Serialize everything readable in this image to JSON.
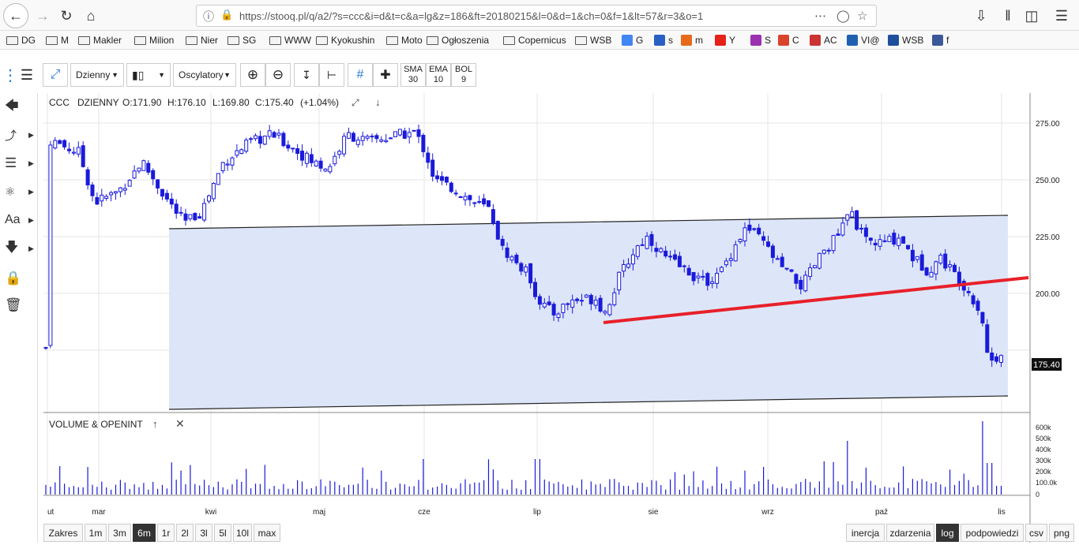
{
  "browser": {
    "url": "https://stooq.pl/q/a2/?s=ccc&i=d&t=c&a=lg&z=186&ft=20180215&l=0&d=1&ch=0&f=1&lt=57&r=3&o=1"
  },
  "bookmarks": [
    {
      "label": "DG",
      "icon": "folder-icon"
    },
    {
      "label": "M",
      "icon": "folder-icon"
    },
    {
      "label": "Makler",
      "icon": "folder-icon"
    },
    {
      "label": "Milion",
      "icon": "folder-icon"
    },
    {
      "label": "Nier",
      "icon": "folder-icon"
    },
    {
      "label": "SG",
      "icon": "folder-icon"
    },
    {
      "label": "WWW",
      "icon": "folder-icon"
    },
    {
      "label": "Kyokushin",
      "icon": "folder-icon"
    },
    {
      "label": "Moto",
      "icon": "folder-icon"
    },
    {
      "label": "Ogłoszenia",
      "icon": "folder-icon"
    },
    {
      "label": "Copernicus",
      "icon": "folder-icon"
    },
    {
      "label": "WSB",
      "icon": "folder-icon"
    },
    {
      "label": "G",
      "icon": "google-icon"
    },
    {
      "label": "s",
      "icon": "oq-icon"
    },
    {
      "label": "m",
      "icon": "m-site-icon"
    },
    {
      "label": "Y",
      "icon": "youtube-icon"
    },
    {
      "label": "S",
      "icon": "s-site-icon"
    },
    {
      "label": "C",
      "icon": "c-site-icon"
    },
    {
      "label": "AC",
      "icon": "ac-site-icon"
    },
    {
      "label": "VI@",
      "icon": "vi-site-icon"
    },
    {
      "label": "WSB",
      "icon": "wsb-site-icon"
    },
    {
      "label": "f",
      "icon": "facebook-icon"
    }
  ],
  "toolbar": {
    "interval": "Dzienny",
    "oscillators": "Oscylatory",
    "indicators": [
      {
        "name": "SMA",
        "value": "30"
      },
      {
        "name": "EMA",
        "value": "10"
      },
      {
        "name": "BOL",
        "value": "9"
      }
    ]
  },
  "chart": {
    "header": {
      "ticker": "CCC",
      "interval": "DZIENNY",
      "open": "O:171.90",
      "high": "H:176.10",
      "low": "L:169.80",
      "close": "C:175.40",
      "change": "(+1.04%)"
    },
    "price_label": "175.40",
    "volume_title": "VOLUME & OPENINT"
  },
  "chart_data": {
    "type": "candlestick",
    "y_ticks": [
      "275.00",
      "250.00",
      "225.00",
      "200.00"
    ],
    "y_range": [
      164,
      289
    ],
    "x_ticks": [
      "ut",
      "mar",
      "kwi",
      "maj",
      "cze",
      "lip",
      "sie",
      "wrz",
      "paź",
      "lis"
    ],
    "volume_ticks": [
      "600k",
      "500k",
      "400k",
      "300k",
      "200k",
      "100.0k",
      "0"
    ],
    "last_close": 175.4,
    "key_closes": [
      {
        "label": "start",
        "value": 268
      },
      {
        "label": "mid-Feb low",
        "value": 240
      },
      {
        "label": "early Apr low",
        "value": 231
      },
      {
        "label": "May high",
        "value": 273
      },
      {
        "label": "end of May",
        "value": 250
      },
      {
        "label": "early Jul low",
        "value": 191
      },
      {
        "label": "end of Jul low",
        "value": 191
      },
      {
        "label": "mid-Sep high",
        "value": 228
      },
      {
        "label": "mid-Oct high",
        "value": 233
      },
      {
        "label": "early Nov low",
        "value": 170
      },
      {
        "label": "last",
        "value": 175.4
      }
    ]
  },
  "bottom": {
    "ranges": [
      "Zakres",
      "1m",
      "3m",
      "6m",
      "1r",
      "2l",
      "3l",
      "5l",
      "10l",
      "max"
    ],
    "active_range": "6m",
    "options": [
      "inercja",
      "zdarzenia",
      "log",
      "podpowiedzi",
      "csv",
      "png"
    ],
    "active_option": "log"
  },
  "colors": {
    "candle": "#1a1adb",
    "channel_fill": "#dde6f8",
    "trendline": "#e8202a"
  }
}
